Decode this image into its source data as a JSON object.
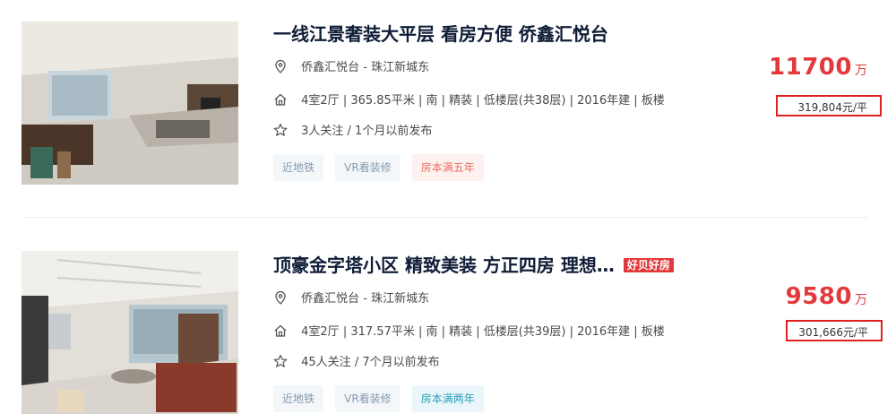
{
  "listings": [
    {
      "title": "一线江景奢装大平层 看房方便 侨鑫汇悦台",
      "location": "侨鑫汇悦台 - 珠江新城东",
      "house_info": "4室2厅 | 365.85平米 | 南 | 精装 | 低楼层(共38层) | 2016年建 | 板楼",
      "follow_info": "3人关注 / 1个月以前发布",
      "tags": [
        "近地铁",
        "VR看装修",
        "房本满五年"
      ],
      "price": "11700",
      "price_unit": "万",
      "unit_price": "319,804元/平"
    },
    {
      "title": "顶豪金字塔小区 精致美装 方正四房 理想…",
      "hot_tag": "好贝好房",
      "location": "侨鑫汇悦台 - 珠江新城东",
      "house_info": "4室2厅 | 317.57平米 | 南 | 精装 | 低楼层(共39层) | 2016年建 | 板楼",
      "follow_info": "45人关注 / 7个月以前发布",
      "tags": [
        "近地铁",
        "VR看装修",
        "房本满两年"
      ],
      "price": "9580",
      "price_unit": "万",
      "unit_price": "301,666元/平"
    }
  ],
  "icons": {
    "location": "location-pin-icon",
    "house": "house-icon",
    "follow": "star-icon"
  },
  "colors": {
    "price": "#e4393c",
    "title": "#101d37",
    "tag_blue_text": "#849aae",
    "tag_red_text": "#ea6d61",
    "tag_teal_text": "#2c9fb6",
    "highlight_box": "#e02020"
  }
}
